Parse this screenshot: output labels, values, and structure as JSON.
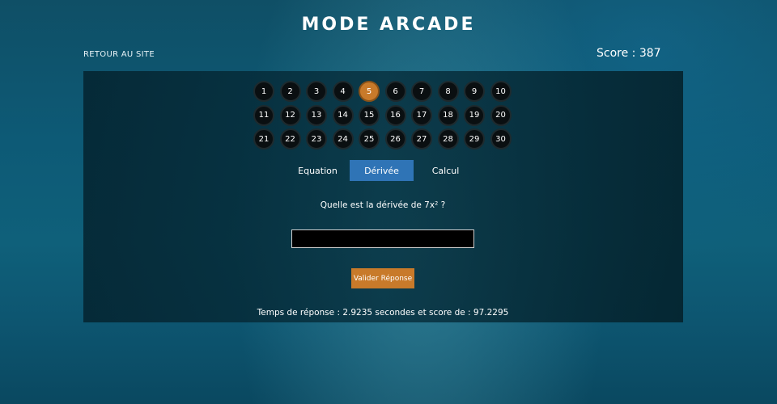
{
  "header": {
    "title": "MODE ARCADE",
    "back_link": "RETOUR AU SITE",
    "score": "Score : 387"
  },
  "levels": {
    "items": [
      "1",
      "2",
      "3",
      "4",
      "5",
      "6",
      "7",
      "8",
      "9",
      "10",
      "11",
      "12",
      "13",
      "14",
      "15",
      "16",
      "17",
      "18",
      "19",
      "20",
      "21",
      "22",
      "23",
      "24",
      "25",
      "26",
      "27",
      "28",
      "29",
      "30"
    ],
    "active": "5"
  },
  "tabs": [
    {
      "label": "Equation",
      "active": false
    },
    {
      "label": "Dérivée",
      "active": true
    },
    {
      "label": "Calcul",
      "active": false
    }
  ],
  "question": "Quelle est la dérivée de 7x² ?",
  "answer": {
    "value": "",
    "placeholder": ""
  },
  "submit_label": "Valider Réponse",
  "result": "Temps de réponse : 2.9235 secondes et score de : 97.2295",
  "colors": {
    "accent_orange": "#c87a2a",
    "tab_active_blue": "#2f74b6",
    "panel_dark": "#052a36"
  }
}
